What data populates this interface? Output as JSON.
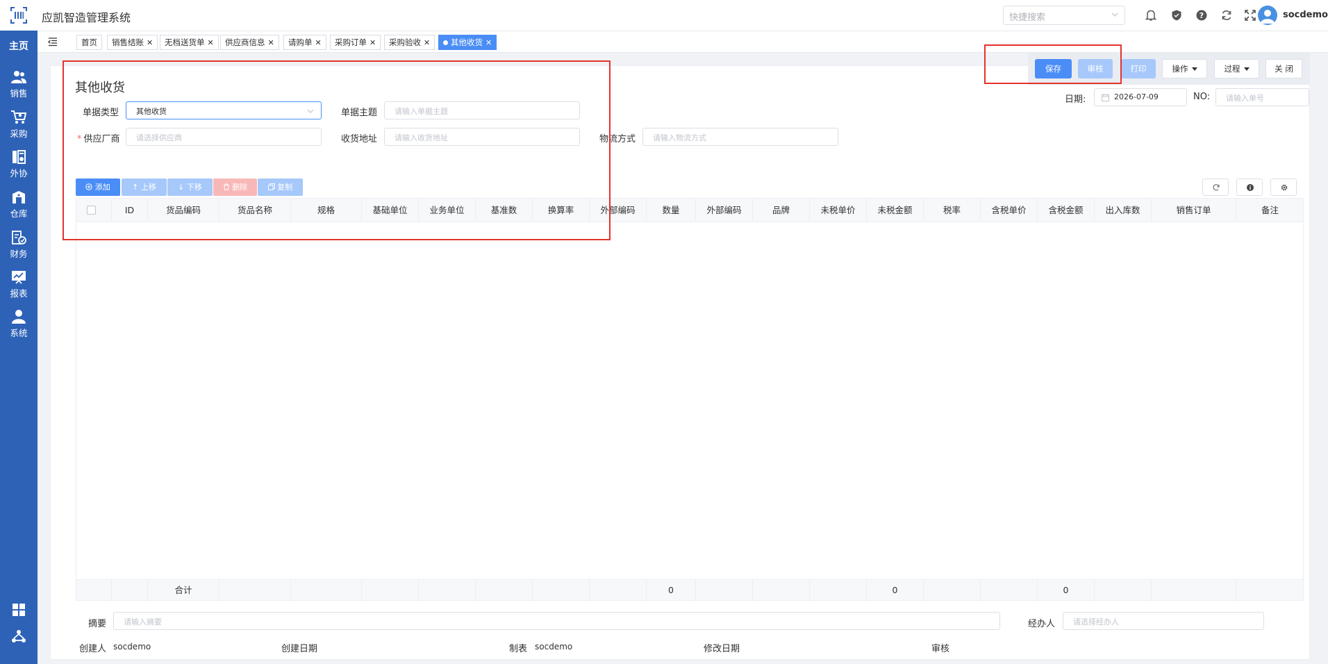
{
  "header": {
    "app_title": "应凯智造管理系统",
    "quick_search_placeholder": "快捷搜索",
    "username": "socdemo"
  },
  "sidebar": {
    "home": "主页",
    "items": [
      {
        "label": "销售",
        "icon": "sales-icon"
      },
      {
        "label": "采购",
        "icon": "purchase-icon"
      },
      {
        "label": "外协",
        "icon": "outsource-icon"
      },
      {
        "label": "仓库",
        "icon": "warehouse-icon"
      },
      {
        "label": "财务",
        "icon": "finance-icon"
      },
      {
        "label": "报表",
        "icon": "report-icon"
      },
      {
        "label": "系统",
        "icon": "system-icon"
      }
    ]
  },
  "tabs": [
    {
      "label": "首页",
      "closable": false
    },
    {
      "label": "销售结账",
      "closable": true
    },
    {
      "label": "无档送货单",
      "closable": true
    },
    {
      "label": "供应商信息",
      "closable": true
    },
    {
      "label": "请购单",
      "closable": true
    },
    {
      "label": "采购订单",
      "closable": true
    },
    {
      "label": "采购验收",
      "closable": true
    },
    {
      "label": "其他收货",
      "closable": true,
      "active": true
    }
  ],
  "actions": {
    "save": "保存",
    "audit": "审核",
    "print": "打印",
    "operate": "操作",
    "process": "过程",
    "close": "关 闭"
  },
  "form": {
    "title": "其他收货",
    "doc_type_label": "单据类型",
    "doc_type_value": "其他收货",
    "subject_label": "单据主题",
    "subject_placeholder": "请输入单据主题",
    "supplier_label": "供应厂商",
    "supplier_placeholder": "请选择供应商",
    "address_label": "收货地址",
    "address_placeholder": "请输入收货地址",
    "logistics_label": "物流方式",
    "logistics_placeholder": "请输入物流方式",
    "date_label": "日期:",
    "date_value": "2026-07-09",
    "no_label": "NO:",
    "no_placeholder": "请输入单号"
  },
  "toolbar": {
    "add": "添加",
    "up": "上移",
    "down": "下移",
    "delete": "删除",
    "copy": "复制"
  },
  "table": {
    "columns": [
      "ID",
      "货品编码",
      "货品名称",
      "规格",
      "基础单位",
      "业务单位",
      "基准数",
      "换算率",
      "外部编码",
      "数量",
      "外部编码",
      "品牌",
      "未税单价",
      "未税金额",
      "税率",
      "含税单价",
      "含税金额",
      "出入库数",
      "销售订单",
      "备注"
    ],
    "rows": [],
    "total_label": "合计",
    "totals": {
      "quantity": "0",
      "untaxed_amount": "0",
      "taxed_amount": "0"
    }
  },
  "footer": {
    "summary_label": "摘要",
    "summary_placeholder": "请输入摘要",
    "handler_label": "经办人",
    "handler_placeholder": "请选择经办人",
    "creator_label": "创建人",
    "creator_value": "socdemo",
    "created_date_label": "创建日期",
    "maker_label": "制表",
    "maker_value": "socdemo",
    "modified_date_label": "修改日期",
    "auditor_label": "审核"
  },
  "colors": {
    "sidebar_bg": "#2d62b7",
    "primary": "#4a8df6",
    "primary_light": "#a6c8fb",
    "danger_light": "#f9b8b8",
    "annotation": "#e5322d"
  }
}
